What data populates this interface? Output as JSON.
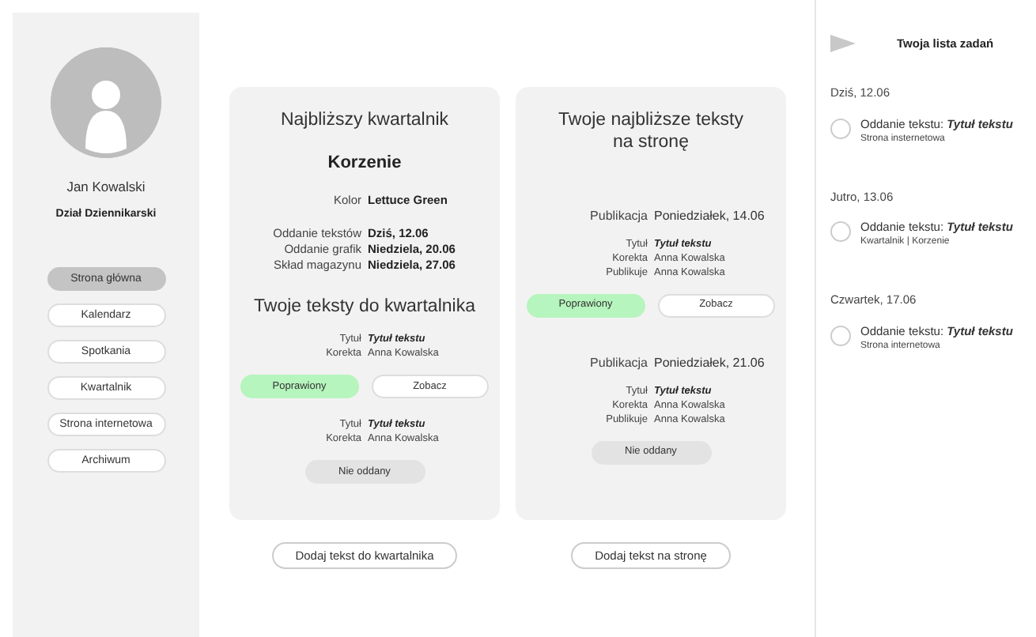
{
  "profile": {
    "name": "Jan Kowalski",
    "department": "Dział Dziennikarski"
  },
  "nav": [
    {
      "label": "Strona główna",
      "selected": true
    },
    {
      "label": "Kalendarz",
      "selected": false
    },
    {
      "label": "Spotkania",
      "selected": false
    },
    {
      "label": "Kwartalnik",
      "selected": false
    },
    {
      "label": "Strona internetowa",
      "selected": false
    },
    {
      "label": "Archiwum",
      "selected": false
    }
  ],
  "quarterly": {
    "title": "Najbliższy kwartalnik",
    "issue": "Korzenie",
    "color_row": {
      "label": "Kolor",
      "value": "Lettuce Green"
    },
    "dates": [
      {
        "label": "Oddanie tekstów",
        "value": "Dziś, 12.06"
      },
      {
        "label": "Oddanie grafik",
        "value": "Niedziela, 20.06"
      },
      {
        "label": "Skład magazynu",
        "value": "Niedziela, 27.06"
      }
    ],
    "subtitle": "Twoje teksty do kwartalnika",
    "texts": [
      {
        "fields": [
          {
            "label": "Tytuł",
            "value": "Tytuł tekstu",
            "kind": "title"
          },
          {
            "label": "Korekta",
            "value": "Anna Kowalska",
            "kind": "plain"
          }
        ],
        "status": {
          "kind": "corrected",
          "label": "Poprawiony"
        },
        "view": "Zobacz"
      },
      {
        "fields": [
          {
            "label": "Tytuł",
            "value": "Tytuł tekstu",
            "kind": "title"
          },
          {
            "label": "Korekta",
            "value": "Anna Kowalska",
            "kind": "plain"
          }
        ],
        "status": {
          "kind": "pending",
          "label": "Nie oddany"
        }
      }
    ],
    "add_button": "Dodaj tekst do kwartalnika"
  },
  "website": {
    "title": "Twoje najbliższe teksty na stronę",
    "texts": [
      {
        "publication": {
          "label": "Publikacja",
          "value": "Poniedziałek, 14.06"
        },
        "fields": [
          {
            "label": "Tytuł",
            "value": "Tytuł tekstu",
            "kind": "title"
          },
          {
            "label": "Korekta",
            "value": "Anna Kowalska",
            "kind": "plain"
          },
          {
            "label": "Publikuje",
            "value": "Anna Kowalska",
            "kind": "plain"
          }
        ],
        "status": {
          "kind": "corrected",
          "label": "Poprawiony"
        },
        "view": "Zobacz"
      },
      {
        "publication": {
          "label": "Publikacja",
          "value": "Poniedziałek, 21.06"
        },
        "fields": [
          {
            "label": "Tytuł",
            "value": "Tytuł tekstu",
            "kind": "title"
          },
          {
            "label": "Korekta",
            "value": "Anna Kowalska",
            "kind": "plain"
          },
          {
            "label": "Publikuje",
            "value": "Anna Kowalska",
            "kind": "plain"
          }
        ],
        "status": {
          "kind": "pending",
          "label": "Nie oddany"
        }
      }
    ],
    "add_button": "Dodaj tekst na stronę"
  },
  "tasks": {
    "title": "Twoja lista zadań",
    "groups": [
      {
        "date": "Dziś, 12.06",
        "items": [
          {
            "text": "Oddanie tekstu: **Tytuł tekstu**",
            "sub": "Strona insternetowa",
            "checked": false
          }
        ]
      },
      {
        "date": "Jutro, 13.06",
        "items": [
          {
            "text": "Oddanie tekstu: **Tytuł tekstu**",
            "sub": "Kwartalnik | Korzenie",
            "checked": false
          }
        ]
      },
      {
        "date": "Czwartek, 17.06",
        "items": [
          {
            "text": "Oddanie tekstu: **Tytuł tekstu**",
            "sub": "Strona internetowa",
            "checked": false
          }
        ]
      }
    ]
  }
}
